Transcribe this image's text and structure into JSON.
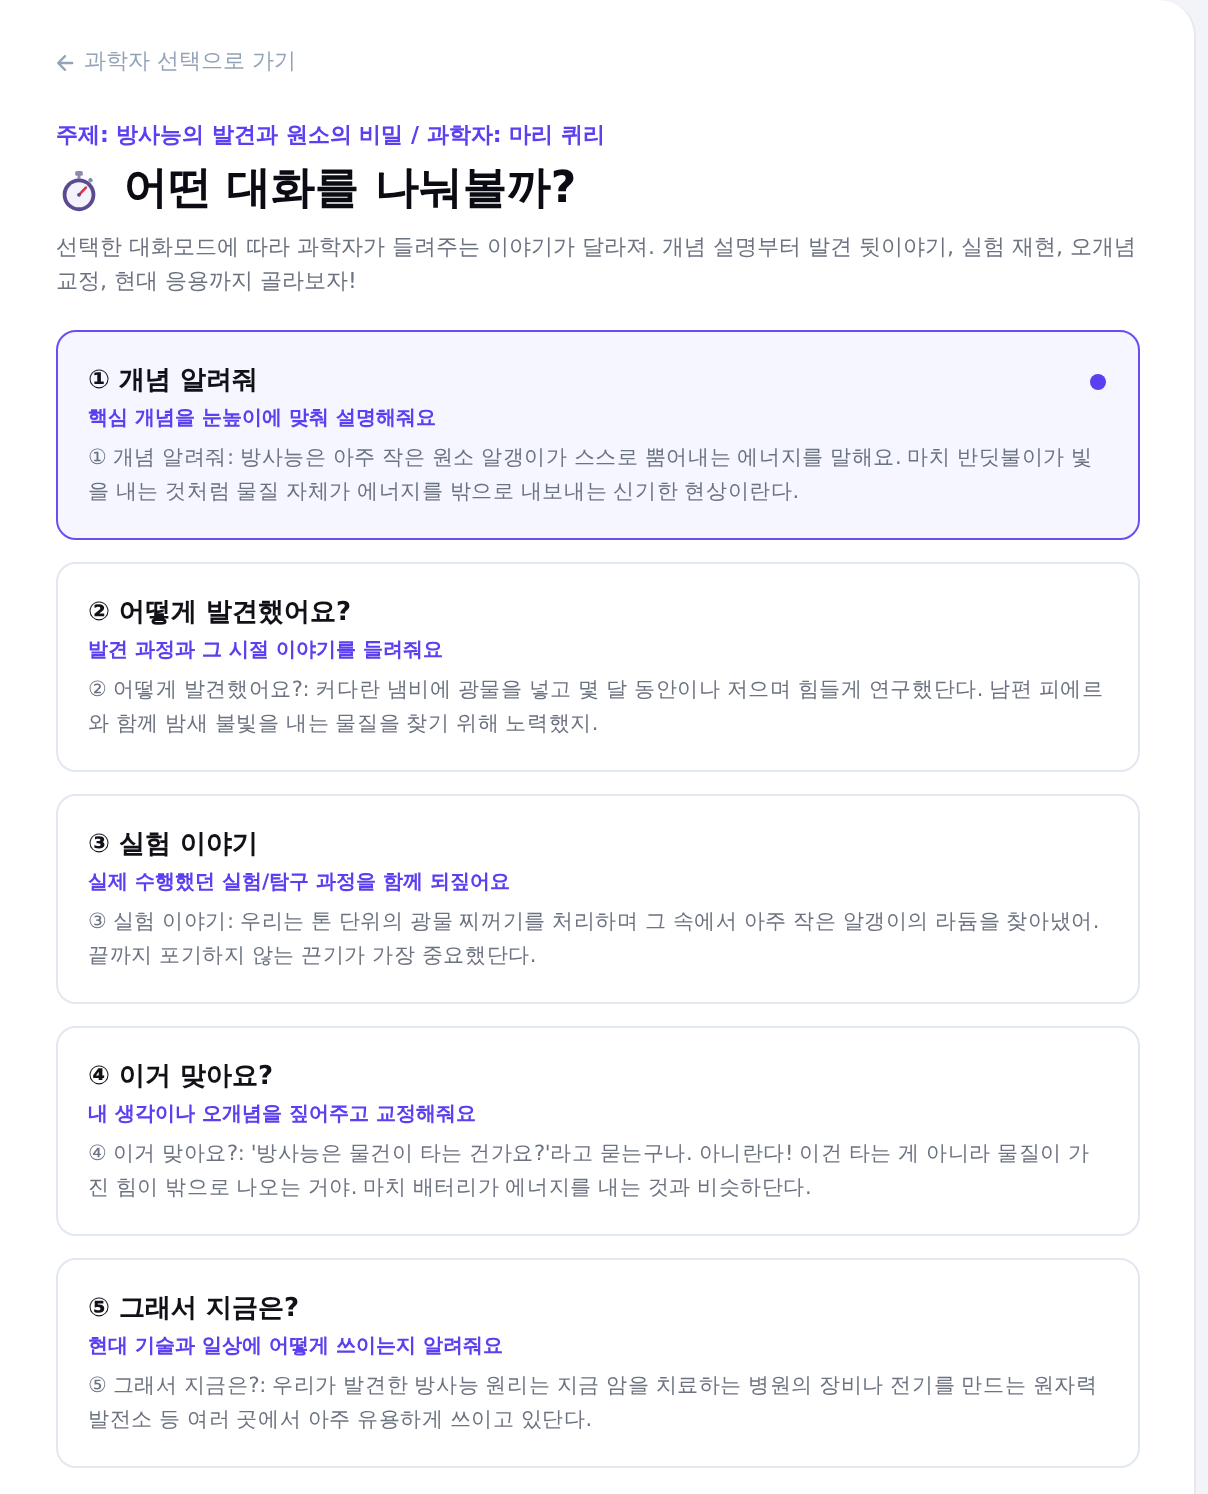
{
  "back_link": {
    "label": "과학자 선택으로 가기"
  },
  "topic": "주제: 방사능의 발견과 원소의 비밀 / 과학자: 마리 퀴리",
  "heading": "어떤 대화를 나눠볼까?",
  "description": "선택한 대화모드에 따라 과학자가 들려주는 이야기가 달라져. 개념 설명부터 발견 뒷이야기, 실험 재현, 오개념 교정, 현대 응용까지 골라보자!",
  "modes": [
    {
      "title": "① 개념 알려줘",
      "subtitle": "핵심 개념을 눈높이에 맞춰 설명해줘요",
      "preview": "① 개념 알려줘: 방사능은 아주 작은 원소 알갱이가 스스로 뿜어내는 에너지를 말해요. 마치 반딧불이가 빛을 내는 것처럼 물질 자체가 에너지를 밖으로 내보내는 신기한 현상이란다.",
      "selected": true
    },
    {
      "title": "② 어떻게 발견했어요?",
      "subtitle": "발견 과정과 그 시절 이야기를 들려줘요",
      "preview": "② 어떻게 발견했어요?: 커다란 냄비에 광물을 넣고 몇 달 동안이나 저으며 힘들게 연구했단다. 남편 피에르와 함께 밤새 불빛을 내는 물질을 찾기 위해 노력했지.",
      "selected": false
    },
    {
      "title": "③ 실험 이야기",
      "subtitle": "실제 수행했던 실험/탐구 과정을 함께 되짚어요",
      "preview": "③ 실험 이야기: 우리는 톤 단위의 광물 찌꺼기를 처리하며 그 속에서 아주 작은 알갱이의 라듐을 찾아냈어. 끝까지 포기하지 않는 끈기가 가장 중요했단다.",
      "selected": false
    },
    {
      "title": "④ 이거 맞아요?",
      "subtitle": "내 생각이나 오개념을 짚어주고 교정해줘요",
      "preview": "④ 이거 맞아요?: '방사능은 물건이 타는 건가요?'라고 묻는구나. 아니란다! 이건 타는 게 아니라 물질이 가진 힘이 밖으로 나오는 거야. 마치 배터리가 에너지를 내는 것과 비슷하단다.",
      "selected": false
    },
    {
      "title": "⑤ 그래서 지금은?",
      "subtitle": "현대 기술과 일상에 어떻게 쓰이는지 알려줘요",
      "preview": "⑤ 그래서 지금은?: 우리가 발견한 방사능 원리는 지금 암을 치료하는 병원의 장비나 전기를 만드는 원자력 발전소 등 여러 곳에서 아주 유용하게 쓰이고 있단다.",
      "selected": false
    }
  ]
}
